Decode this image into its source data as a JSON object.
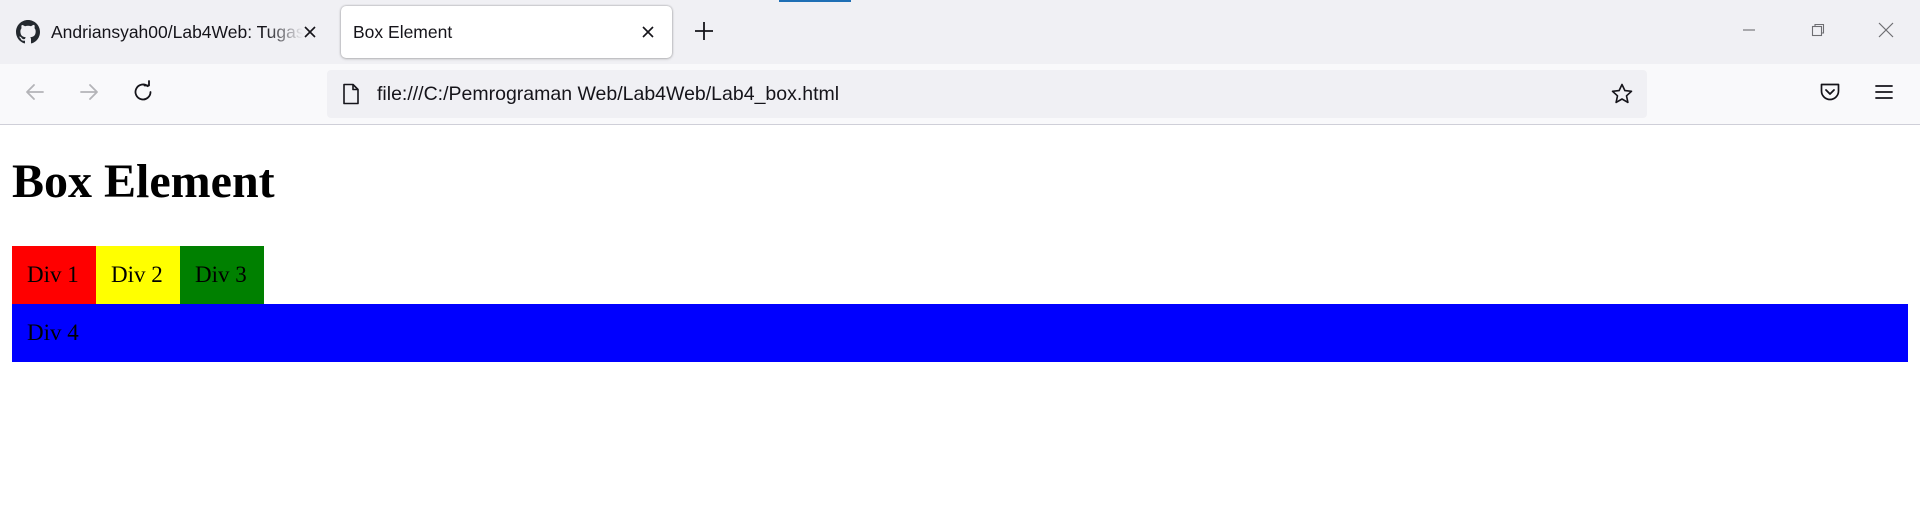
{
  "tabs": [
    {
      "title": "Andriansyah00/Lab4Web: Tugas",
      "icon": "github-icon",
      "active": false
    },
    {
      "title": "Box Element",
      "icon": "",
      "active": true
    }
  ],
  "toolbar": {
    "url": "file:///C:/Pemrograman Web/Lab4Web/Lab4_box.html"
  },
  "page": {
    "heading": "Box Element",
    "boxes": [
      {
        "label": "Div 1",
        "color": "#ff0000"
      },
      {
        "label": "Div 2",
        "color": "#ffff00"
      },
      {
        "label": "Div 3",
        "color": "#008000"
      },
      {
        "label": "Div 4",
        "color": "#0000ff"
      }
    ]
  },
  "icons": {
    "tab_close": "close-icon",
    "new_tab": "plus-icon",
    "back": "arrow-left-icon",
    "forward": "arrow-right-icon",
    "reload": "reload-icon",
    "page": "page-icon",
    "bookmark": "star-icon",
    "pocket": "pocket-icon",
    "menu": "hamburger-menu-icon",
    "minimize": "minimize-icon",
    "restore": "restore-icon",
    "close_window": "close-icon"
  }
}
